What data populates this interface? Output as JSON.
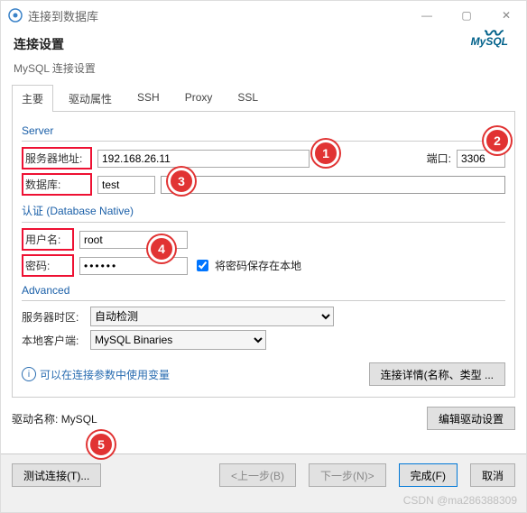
{
  "title": "连接到数据库",
  "header": {
    "title": "连接设置",
    "subtitle": "MySQL 连接设置",
    "logo": "MySQL"
  },
  "tabs": {
    "t0": "主要",
    "t1": "驱动属性",
    "t2": "SSH",
    "t3": "Proxy",
    "t4": "SSL"
  },
  "server": {
    "group": "Server",
    "host_label": "服务器地址:",
    "host": "192.168.26.11",
    "port_label": "端口:",
    "port": "3306",
    "db_label": "数据库:",
    "db": "test"
  },
  "auth": {
    "group": "认证 (Database Native)",
    "user_label": "用户名:",
    "user": "root",
    "pass_label": "密码:",
    "pass": "••••••",
    "save_pass": "将密码保存在本地",
    "save_pass_checked": true
  },
  "advanced": {
    "group": "Advanced",
    "tz_label": "服务器时区:",
    "tz": "自动检测",
    "client_label": "本地客户端:",
    "client": "MySQL Binaries"
  },
  "misc": {
    "vars_info": "可以在连接参数中使用变量",
    "details_btn": "连接详情(名称、类型 ...",
    "driver_label": "驱动名称:",
    "driver_name": "MySQL",
    "edit_driver": "编辑驱动设置"
  },
  "actions": {
    "test": "测试连接(T)...",
    "back": "<上一步(B)",
    "next": "下一步(N)>",
    "finish": "完成(F)",
    "cancel": "取消"
  },
  "badges": {
    "b1": "1",
    "b2": "2",
    "b3": "3",
    "b4": "4",
    "b5": "5"
  },
  "watermark": "CSDN @ma286388309"
}
